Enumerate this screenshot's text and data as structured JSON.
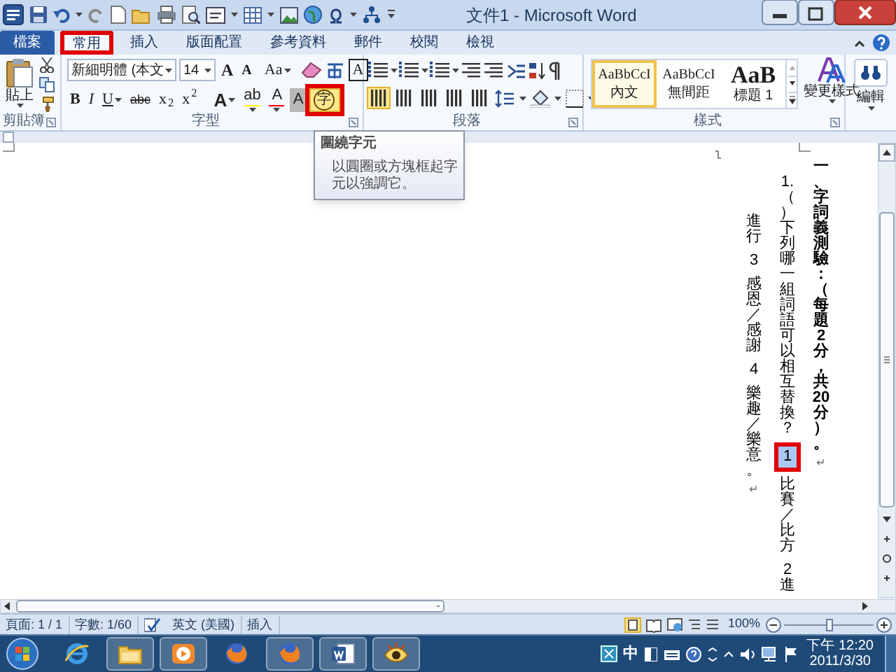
{
  "window": {
    "title": "文件1 - Microsoft Word"
  },
  "tabs": [
    {
      "label": "檔案",
      "kind": "file",
      "selected": false,
      "annotated": false
    },
    {
      "label": "常用",
      "kind": "tab",
      "selected": true,
      "annotated": true
    },
    {
      "label": "插入",
      "kind": "tab",
      "selected": false,
      "annotated": false
    },
    {
      "label": "版面配置",
      "kind": "tab",
      "selected": false,
      "annotated": false
    },
    {
      "label": "參考資料",
      "kind": "tab",
      "selected": false,
      "annotated": false
    },
    {
      "label": "郵件",
      "kind": "tab",
      "selected": false,
      "annotated": false
    },
    {
      "label": "校閱",
      "kind": "tab",
      "selected": false,
      "annotated": false
    },
    {
      "label": "檢視",
      "kind": "tab",
      "selected": false,
      "annotated": false
    }
  ],
  "clipboard": {
    "paste": "貼上",
    "group_label": "剪貼簿"
  },
  "font": {
    "name": "新細明體 (本文",
    "size": "14",
    "group_label": "字型",
    "row1": [
      {
        "label": "A",
        "kind": "grow"
      },
      {
        "label": "A",
        "kind": "shrink"
      },
      {
        "label": "Aa",
        "kind": "case"
      },
      {
        "label": "A",
        "kind": "boxed"
      }
    ],
    "row2": [
      {
        "label": "B",
        "kind": "bold",
        "hovered": false,
        "annotated": false
      },
      {
        "label": "I",
        "kind": "italic",
        "hovered": false,
        "annotated": false
      },
      {
        "label": "U",
        "kind": "underline",
        "hovered": false,
        "annotated": false
      },
      {
        "label": "abc",
        "kind": "strike",
        "hovered": false,
        "annotated": false
      },
      {
        "label": "x$_{2}$",
        "kind": "script",
        "hovered": false,
        "annotated": false
      },
      {
        "label": "x$^{2}$",
        "kind": "script",
        "hovered": false,
        "annotated": false
      },
      {
        "label": "A",
        "kind": "effects",
        "hovered": false,
        "annotated": false
      },
      {
        "label": "ab",
        "kind": "highlight",
        "color": "#ffff00",
        "hovered": false,
        "annotated": false
      },
      {
        "label": "A",
        "kind": "fontcolor",
        "color": "#ff0000",
        "hovered": false,
        "annotated": false
      },
      {
        "label": "A",
        "kind": "shading",
        "hovered": false,
        "annotated": false
      },
      {
        "label": "字",
        "kind": "enclose",
        "hovered": true,
        "annotated": true
      }
    ]
  },
  "paragraph": {
    "group_label": "段落"
  },
  "styles": {
    "items": [
      {
        "sample": "AaBbCcI",
        "label": "內文",
        "kind": "normal",
        "selected": true
      },
      {
        "sample": "AaBbCcI",
        "label": "無間距",
        "kind": "normal",
        "selected": false
      },
      {
        "sample": "AaB",
        "label": "標題 1",
        "kind": "heading",
        "selected": false
      }
    ],
    "change_styles": "變更樣式",
    "group_label": "樣式"
  },
  "editing": {
    "label": "編輯"
  },
  "tooltip": {
    "title": "圍繞字元",
    "body": "以圓圈或方塊框起字元以強調它。"
  },
  "document": {
    "columns": [
      {
        "kind": "heading",
        "segments": [
          {
            "text": "一、字詞義測驗：（每題2分，共20分）。",
            "selected": false,
            "annotated": false
          }
        ],
        "end_mark": "↵"
      },
      {
        "kind": "question",
        "segments": [
          {
            "text": "1.（）下列哪一組詞語可以相互替換？",
            "selected": false,
            "annotated": false
          },
          {
            "text": "1",
            "selected": true,
            "annotated": true
          },
          {
            "text": "比賽／比方 2進",
            "selected": false,
            "annotated": false
          }
        ]
      },
      {
        "kind": "continuation",
        "segments": [
          {
            "text": "進行 3 感恩／感謝 4 樂趣／樂意。",
            "selected": false,
            "annotated": false
          }
        ],
        "end_mark": "↵"
      }
    ]
  },
  "status_bar": {
    "page": "頁面: 1 / 1",
    "words": "字數: 1/60",
    "language": "英文 (美國)",
    "mode": "插入",
    "zoom": "100%",
    "zoom_slider": {
      "level": 0.5
    }
  },
  "taskbar": {
    "apps": [
      {
        "kind": "ie",
        "running": false
      },
      {
        "kind": "folder",
        "running": true
      },
      {
        "kind": "media",
        "running": true
      },
      {
        "kind": "firefox",
        "running": false
      },
      {
        "kind": "firefox",
        "running": true
      },
      {
        "kind": "word",
        "running": true
      },
      {
        "kind": "viewer",
        "running": true
      }
    ],
    "ime": "中",
    "time": "下午 12:20",
    "date": "2011/3/30"
  }
}
